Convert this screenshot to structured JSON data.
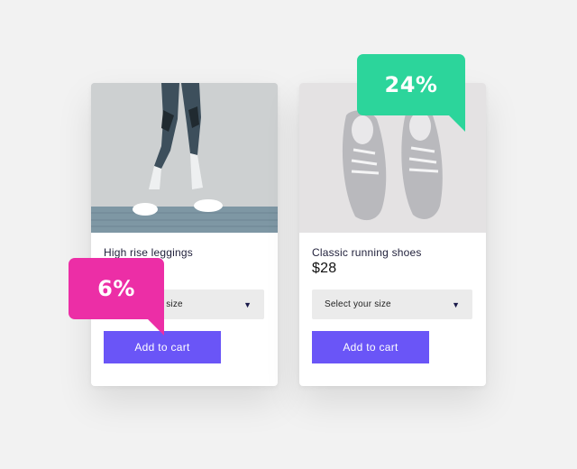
{
  "products": [
    {
      "name": "High rise leggings",
      "price": "",
      "select_placeholder": "Select your size",
      "button_label": "Add to cart",
      "discount": "6%",
      "discount_color": "#ec2ea6"
    },
    {
      "name": "Classic running shoes",
      "price": "$28",
      "select_placeholder": "Select your size",
      "button_label": "Add to cart",
      "discount": "24%",
      "discount_color": "#2cd59b"
    }
  ],
  "icons": {
    "dropdown": "chevron-down-icon"
  },
  "colors": {
    "button": "#6a55f7",
    "select_bg": "#ebebeb"
  }
}
